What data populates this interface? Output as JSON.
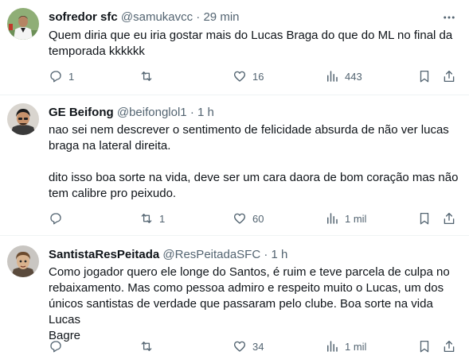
{
  "tweets": [
    {
      "name": "sofredor sfc",
      "handle": "@samukavcc",
      "separator": "·",
      "time": "29 min",
      "text": "Quem diria que eu iria gostar mais do Lucas Braga do que do ML no final da\ntemporada kkkkkk",
      "replies": "1",
      "retweets": "",
      "likes": "16",
      "views": "443"
    },
    {
      "name": "GE Beifong",
      "handle": "@beifonglol1",
      "separator": "·",
      "time": "1 h",
      "text": "nao sei nem descrever o sentimento de felicidade absurda de não ver lucas\nbraga na lateral direita.\n\ndito isso boa sorte na vida, deve ser um cara daora de bom coração mas não\ntem calibre pro peixudo.",
      "replies": "",
      "retweets": "1",
      "likes": "60",
      "views": "1 mil"
    },
    {
      "name": "SantistaResPeitada",
      "handle": "@ResPeitadaSFC",
      "separator": "·",
      "time": "1 h",
      "text": "Como jogador quero ele longe do Santos, é ruim e teve parcela de culpa no\nrebaixamento. Mas como pessoa admiro e respeito muito o Lucas, um dos\núnicos santistas de verdade que passaram pelo clube. Boa sorte na vida Lucas\nBagre",
      "replies": "",
      "retweets": "",
      "likes": "34",
      "views": "1 mil"
    }
  ],
  "icons": {
    "more": "more-horizontal-icon",
    "reply": "reply-icon",
    "retweet": "retweet-icon",
    "like": "heart-icon",
    "views": "views-icon",
    "bookmark": "bookmark-icon",
    "share": "share-icon"
  },
  "colors": {
    "text": "#0f1419",
    "secondary": "#536471",
    "divider": "#eff3f4"
  }
}
